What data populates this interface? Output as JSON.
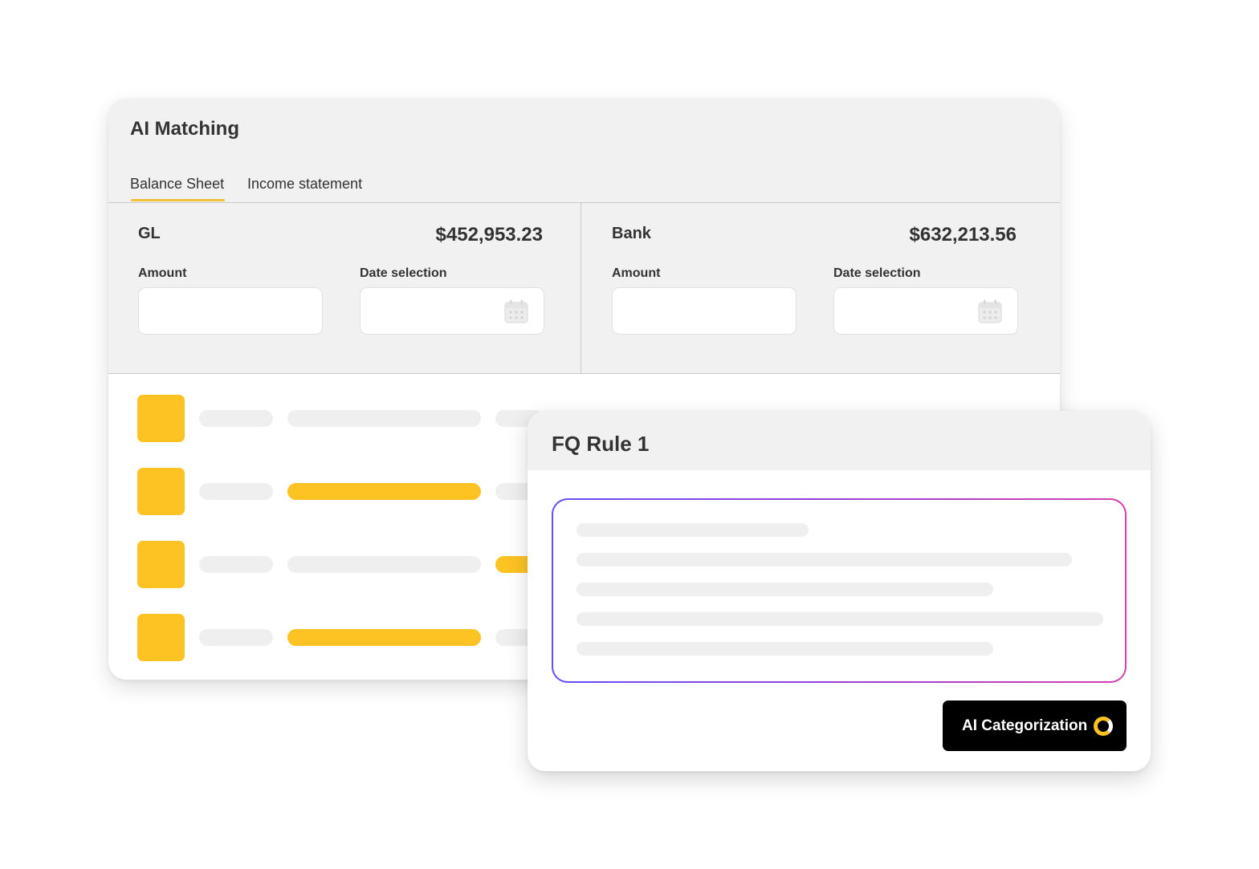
{
  "app": {
    "title": "AI Matching"
  },
  "tabs": [
    {
      "label": "Balance Sheet",
      "active": true
    },
    {
      "label": "Income statement",
      "active": false
    }
  ],
  "panels": {
    "gl": {
      "label": "GL",
      "amount": "$452,953.23",
      "amount_field_label": "Amount",
      "date_field_label": "Date selection",
      "amount_value": "",
      "date_value": ""
    },
    "bank": {
      "label": "Bank",
      "amount": "$632,213.56",
      "amount_field_label": "Amount",
      "date_field_label": "Date selection",
      "amount_value": "",
      "date_value": ""
    }
  },
  "rule": {
    "title": "FQ Rule 1",
    "button_label": "AI Categorization",
    "button_icon": "loading-spinner-icon"
  },
  "colors": {
    "accent": "#fdc323",
    "tab_underline": "#f2c13c",
    "header_bg": "#f1f1f1",
    "gradient_start": "#6a4df5",
    "gradient_end": "#d63fae",
    "button_bg": "#000000"
  }
}
